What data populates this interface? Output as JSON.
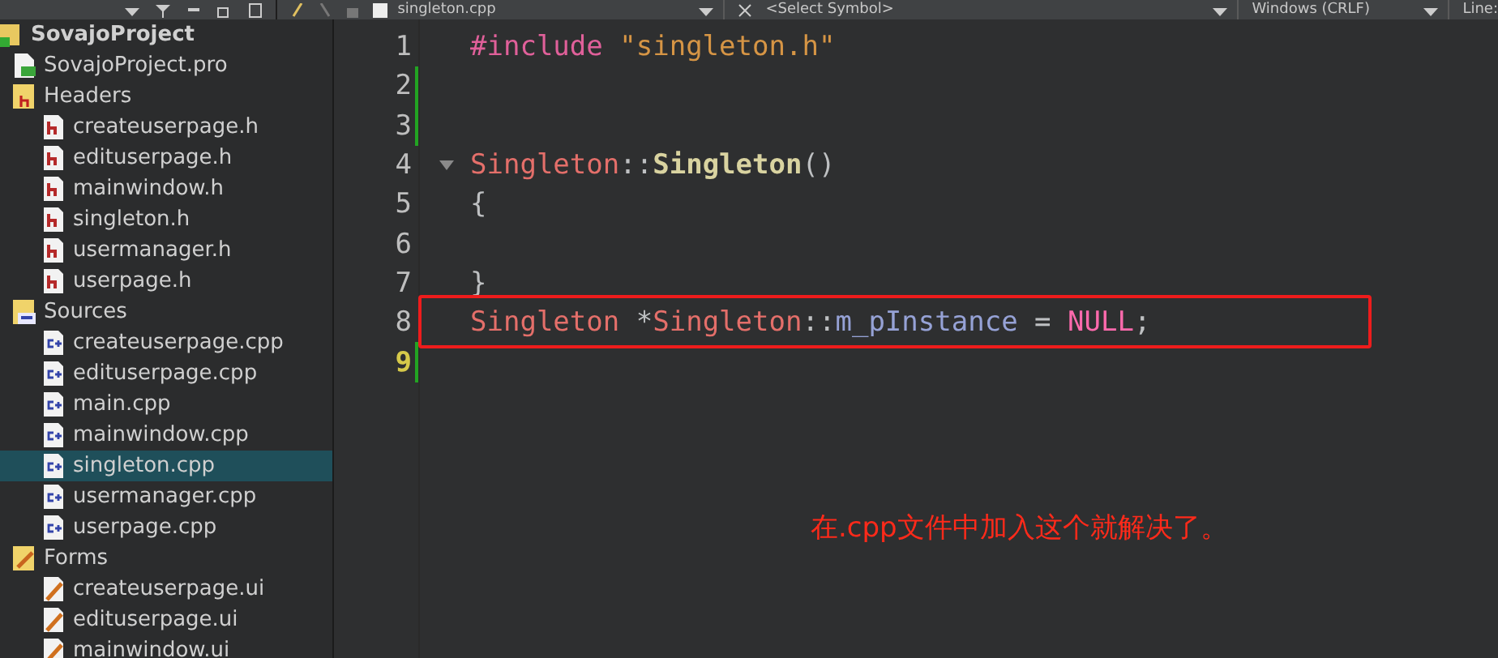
{
  "editor_toolbar": {
    "file": "singleton.cpp",
    "symbol": "<Select Symbol>",
    "line_ending": "Windows (CRLF)",
    "position": "Line:"
  },
  "project_tree": [
    {
      "label": "SovajoProject",
      "kind": "project",
      "selected": false,
      "children": [
        {
          "label": "SovajoProject.pro",
          "kind": "pro",
          "selected": false
        },
        {
          "label": "Headers",
          "kind": "headers",
          "selected": false,
          "children": [
            {
              "label": "createuserpage.h",
              "kind": "header",
              "selected": false
            },
            {
              "label": "edituserpage.h",
              "kind": "header",
              "selected": false
            },
            {
              "label": "mainwindow.h",
              "kind": "header",
              "selected": false
            },
            {
              "label": "singleton.h",
              "kind": "header",
              "selected": false
            },
            {
              "label": "usermanager.h",
              "kind": "header",
              "selected": false
            },
            {
              "label": "userpage.h",
              "kind": "header",
              "selected": false
            }
          ]
        },
        {
          "label": "Sources",
          "kind": "sources",
          "selected": false,
          "children": [
            {
              "label": "createuserpage.cpp",
              "kind": "source",
              "selected": false
            },
            {
              "label": "edituserpage.cpp",
              "kind": "source",
              "selected": false
            },
            {
              "label": "main.cpp",
              "kind": "source",
              "selected": false
            },
            {
              "label": "mainwindow.cpp",
              "kind": "source",
              "selected": false
            },
            {
              "label": "singleton.cpp",
              "kind": "source",
              "selected": true
            },
            {
              "label": "usermanager.cpp",
              "kind": "source",
              "selected": false
            },
            {
              "label": "userpage.cpp",
              "kind": "source",
              "selected": false
            }
          ]
        },
        {
          "label": "Forms",
          "kind": "forms",
          "selected": false,
          "children": [
            {
              "label": "createuserpage.ui",
              "kind": "form",
              "selected": false
            },
            {
              "label": "edituserpage.ui",
              "kind": "form",
              "selected": false
            },
            {
              "label": "mainwindow.ui",
              "kind": "form",
              "selected": false
            }
          ]
        }
      ]
    }
  ],
  "code_lines": [
    {
      "number": "1",
      "current": false,
      "changed": false,
      "foldable": false,
      "tokens": [
        {
          "text": "#include",
          "kind": "preproc"
        },
        {
          "text": " \"singleton.h\"",
          "kind": "string"
        }
      ]
    },
    {
      "number": "2",
      "current": false,
      "changed": true,
      "foldable": false
    },
    {
      "number": "3",
      "current": false,
      "changed": true,
      "foldable": false
    },
    {
      "number": "4",
      "current": false,
      "changed": false,
      "foldable": true,
      "tokens": [
        {
          "text": "Singleton",
          "kind": "type"
        },
        {
          "text": "::",
          "kind": "punct"
        },
        {
          "text": "Singleton",
          "kind": "function"
        },
        {
          "text": "()",
          "kind": "punct"
        }
      ]
    },
    {
      "number": "5",
      "current": false,
      "changed": false,
      "foldable": false,
      "tokens": [
        {
          "text": "{",
          "kind": "punct"
        }
      ]
    },
    {
      "number": "6",
      "current": false,
      "changed": false,
      "foldable": false
    },
    {
      "number": "7",
      "current": false,
      "changed": false,
      "foldable": false,
      "tokens": [
        {
          "text": "}",
          "kind": "punct"
        }
      ]
    },
    {
      "number": "8",
      "current": false,
      "changed": false,
      "foldable": false,
      "tokens": [
        {
          "text": "Singleton",
          "kind": "type"
        },
        {
          "text": " *",
          "kind": "punct"
        },
        {
          "text": "Singleton",
          "kind": "type"
        },
        {
          "text": "::",
          "kind": "punct"
        },
        {
          "text": "m_pInstance",
          "kind": "member"
        },
        {
          "text": " = ",
          "kind": "punct"
        },
        {
          "text": "NULL",
          "kind": "keyword"
        },
        {
          "text": ";",
          "kind": "punct"
        }
      ]
    },
    {
      "number": "9",
      "current": true,
      "changed": true,
      "foldable": false
    }
  ],
  "annotation": "在.cpp文件中加入这个就解决了。"
}
